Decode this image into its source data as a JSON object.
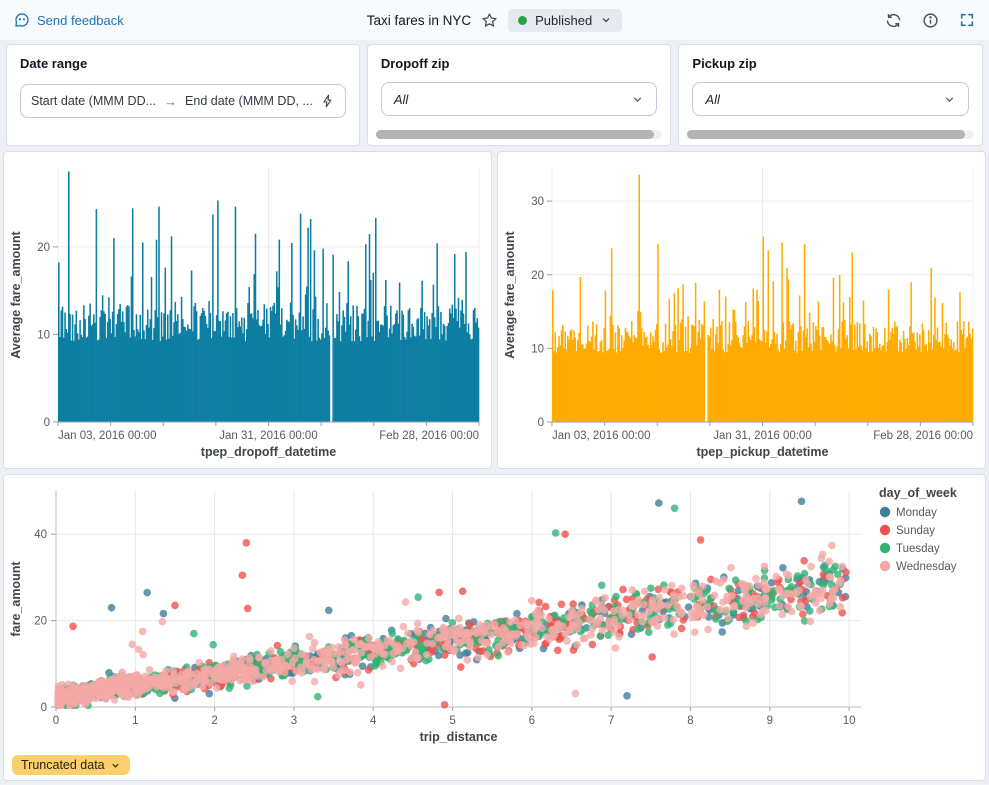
{
  "header": {
    "feedback": "Send feedback",
    "title": "Taxi fares in NYC",
    "status": "Published"
  },
  "filters": {
    "date_range": {
      "label": "Date range",
      "start_placeholder": "Start date (MMM DD...",
      "end_placeholder": "End date (MMM DD, ..."
    },
    "dropoff_zip": {
      "label": "Dropoff zip",
      "value": "All"
    },
    "pickup_zip": {
      "label": "Pickup zip",
      "value": "All"
    }
  },
  "footer": {
    "truncated": "Truncated data"
  },
  "colors": {
    "accent_blue": "#2272b4",
    "published_green": "#2aa147",
    "dropoff_bar": "#0d7ea2",
    "pickup_bar": "#ffab02",
    "badge_bg": "#fbd06c"
  },
  "chart_data": [
    {
      "type": "bar",
      "name": "avg-fare-by-dropoff-time",
      "ylabel": "Average fare_amount",
      "xlabel": "tpep_dropoff_datetime",
      "x_ticks": [
        "Jan 03, 2016 00:00",
        "Jan 31, 2016 00:00",
        "Feb 28, 2016 00:00"
      ],
      "y_ticks": [
        0,
        10,
        20
      ],
      "ylim": [
        0,
        29
      ],
      "bar_color": "#0d7ea2",
      "bar_count": 336,
      "baseline_range": [
        9.2,
        13.6
      ],
      "spike_chance": 0.17,
      "spike_max": 25.5,
      "peaks": [
        [
          0.0,
          18.2
        ],
        [
          0.025,
          28.6
        ],
        [
          0.09,
          24.3
        ],
        [
          0.13,
          21.0
        ],
        [
          0.175,
          24.4
        ],
        [
          0.2,
          20.5
        ],
        [
          0.24,
          24.6
        ],
        [
          0.27,
          21.2
        ],
        [
          0.315,
          17.3
        ],
        [
          0.38,
          25.3
        ],
        [
          0.42,
          24.6
        ],
        [
          0.47,
          21.5
        ],
        [
          0.52,
          17.2
        ],
        [
          0.575,
          23.8
        ],
        [
          0.61,
          19.6
        ],
        [
          0.655,
          19.1
        ],
        [
          0.73,
          20.3
        ],
        [
          0.78,
          16.2
        ],
        [
          0.9,
          20.4
        ],
        [
          0.97,
          19.4
        ]
      ],
      "gaps": [
        [
          0.649,
          2
        ]
      ],
      "grid": true,
      "seed": 20160103
    },
    {
      "type": "bar",
      "name": "avg-fare-by-pickup-time",
      "ylabel": "Average fare_amount",
      "xlabel": "tpep_pickup_datetime",
      "x_ticks": [
        "Jan 03, 2016 00:00",
        "Jan 31, 2016 00:00",
        "Feb 28, 2016 00:00"
      ],
      "y_ticks": [
        0,
        10,
        20,
        30
      ],
      "ylim": [
        0,
        34.5
      ],
      "bar_color": "#ffab02",
      "bar_count": 336,
      "baseline_range": [
        9.4,
        13.8
      ],
      "spike_chance": 0.17,
      "spike_max": 24.5,
      "peaks": [
        [
          0.0,
          17.9
        ],
        [
          0.065,
          19.7
        ],
        [
          0.14,
          23.6
        ],
        [
          0.205,
          33.6
        ],
        [
          0.25,
          24.2
        ],
        [
          0.31,
          18.7
        ],
        [
          0.36,
          16.4
        ],
        [
          0.43,
          15.3
        ],
        [
          0.5,
          25.2
        ],
        [
          0.56,
          19.4
        ],
        [
          0.6,
          24.2
        ],
        [
          0.67,
          19.6
        ],
        [
          0.74,
          16.5
        ],
        [
          0.8,
          18.0
        ],
        [
          0.9,
          20.9
        ],
        [
          0.97,
          17.6
        ]
      ],
      "gaps": [
        [
          0.365,
          2
        ]
      ],
      "grid": true,
      "seed": 20160214
    },
    {
      "type": "scatter",
      "name": "fare-vs-distance-by-day",
      "xlabel": "trip_distance",
      "ylabel": "fare_amount",
      "x_ticks": [
        0,
        1,
        2,
        3,
        4,
        5,
        6,
        7,
        8,
        9,
        10
      ],
      "y_ticks": [
        0,
        20,
        40
      ],
      "xlim": [
        0,
        10.15
      ],
      "ylim": [
        0,
        50
      ],
      "legend_title": "day_of_week",
      "legend_position": "right",
      "trend": {
        "intercept": 2.3,
        "slope": 2.62,
        "noise_base": 1.0,
        "noise_growth": 2.4,
        "outlier_chance": 0.014,
        "outlier_scale": 16
      },
      "series": [
        {
          "name": "Monday",
          "color": "#3f7e9d",
          "count": 420,
          "x_pow": 1.5,
          "seed": 101
        },
        {
          "name": "Sunday",
          "color": "#f0524d",
          "count": 420,
          "x_pow": 1.5,
          "seed": 202
        },
        {
          "name": "Tuesday",
          "color": "#33b373",
          "count": 540,
          "x_pow": 1.45,
          "seed": 303
        },
        {
          "name": "Wednesday",
          "color": "#f4a9a6",
          "count": 980,
          "x_pow": 2.0,
          "seed": 404
        }
      ],
      "outliers": [
        {
          "series": 1,
          "x": 4.9,
          "y": 0.5
        },
        {
          "series": 1,
          "x": 2.4,
          "y": 38.0
        },
        {
          "series": 2,
          "x": 6.3,
          "y": 40.3
        },
        {
          "series": 1,
          "x": 6.42,
          "y": 40.0
        },
        {
          "series": 0,
          "x": 9.4,
          "y": 47.6
        },
        {
          "series": 2,
          "x": 7.8,
          "y": 46.0
        },
        {
          "series": 0,
          "x": 7.6,
          "y": 47.2
        },
        {
          "series": 2,
          "x": 3.3,
          "y": 2.4
        },
        {
          "series": 0,
          "x": 7.2,
          "y": 2.6
        },
        {
          "series": 3,
          "x": 6.55,
          "y": 3.1
        },
        {
          "series": 0,
          "x": 1.15,
          "y": 26.5
        },
        {
          "series": 1,
          "x": 1.5,
          "y": 23.5
        },
        {
          "series": 0,
          "x": 0.7,
          "y": 23.0
        },
        {
          "series": 1,
          "x": 2.35,
          "y": 30.5
        }
      ]
    }
  ]
}
